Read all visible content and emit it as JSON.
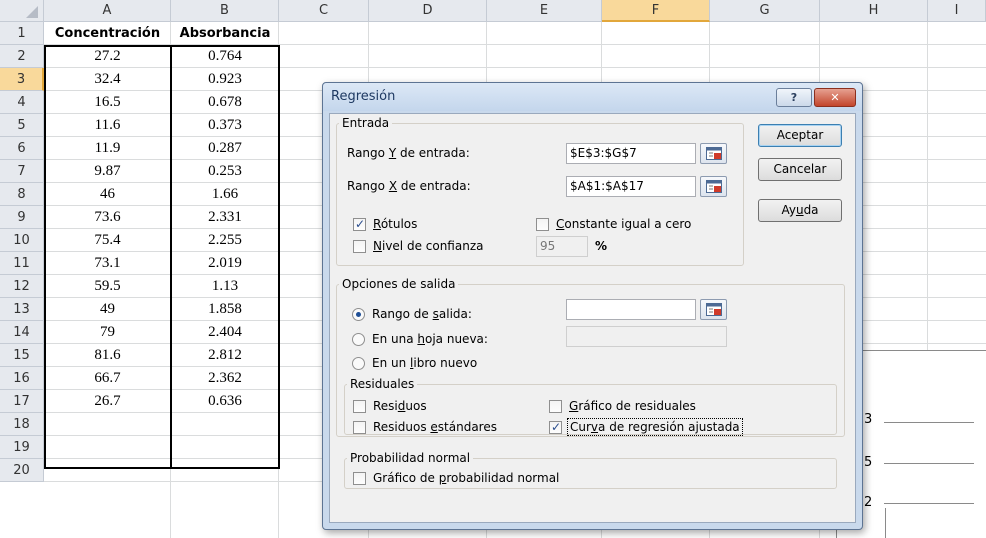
{
  "sheet": {
    "columns": [
      "A",
      "B",
      "C",
      "D",
      "E",
      "F",
      "G",
      "H",
      "I"
    ],
    "selected_column": "F",
    "rows": [
      "1",
      "2",
      "3",
      "4",
      "5",
      "6",
      "7",
      "8",
      "9",
      "10",
      "11",
      "12",
      "13",
      "14",
      "15",
      "16",
      "17",
      "18",
      "19",
      "20"
    ],
    "selected_row": "3",
    "header_a": "Concentración",
    "header_b": "Absorbancia",
    "data": [
      [
        "27.2",
        "0.764"
      ],
      [
        "32.4",
        "0.923"
      ],
      [
        "16.5",
        "0.678"
      ],
      [
        "11.6",
        "0.373"
      ],
      [
        "11.9",
        "0.287"
      ],
      [
        "9.87",
        "0.253"
      ],
      [
        "46",
        "1.66"
      ],
      [
        "73.6",
        "2.331"
      ],
      [
        "75.4",
        "2.255"
      ],
      [
        "73.1",
        "2.019"
      ],
      [
        "59.5",
        "1.13"
      ],
      [
        "49",
        "1.858"
      ],
      [
        "79",
        "2.404"
      ],
      [
        "81.6",
        "2.812"
      ],
      [
        "66.7",
        "2.362"
      ],
      [
        "26.7",
        "0.636"
      ]
    ],
    "chart_fragments": [
      "3",
      "5",
      "2"
    ]
  },
  "dialog": {
    "title": "Regresión",
    "help_glyph": "?",
    "close_glyph": "✕",
    "entrada": {
      "legend": "Entrada",
      "rango_y_label_pre": "Rango ",
      "rango_y_label_key": "Y",
      "rango_y_label_post": " de entrada:",
      "rango_y_value": "$E$3:$G$7",
      "rango_x_label_pre": "Rango ",
      "rango_x_label_key": "X",
      "rango_x_label_post": " de entrada:",
      "rango_x_value": "$A$1:$A$17",
      "rotulos_key": "R",
      "rotulos_rest": "ótulos",
      "rotulos_checked": true,
      "constante_key": "C",
      "constante_rest": "onstante igual a cero",
      "constante_checked": false,
      "nivel_key": "N",
      "nivel_rest": "ivel de confianza",
      "nivel_checked": false,
      "nivel_value": "95",
      "nivel_unit": "%"
    },
    "salida": {
      "legend": "Opciones de salida",
      "rango_salida_pre": "Rango de ",
      "rango_salida_key": "s",
      "rango_salida_post": "alida:",
      "rango_salida_value": "",
      "hoja_pre": "En una ",
      "hoja_key": "h",
      "hoja_post": "oja nueva:",
      "hoja_value": "",
      "libro_pre": "En un ",
      "libro_key": "l",
      "libro_post": "ibro nuevo",
      "selected_option": "rango_salida"
    },
    "residuales": {
      "legend": "Residuales",
      "residuos_pre": "Resi",
      "residuos_key": "d",
      "residuos_post": "uos",
      "residuos_checked": false,
      "estandares_pre": "Residuos ",
      "estandares_key": "e",
      "estandares_post": "stándares",
      "estandares_checked": false,
      "grafico_key": "G",
      "grafico_rest": "ráfico de residuales",
      "grafico_checked": false,
      "curva_pre": "Cur",
      "curva_key": "v",
      "curva_post": "a de regresión ajustada",
      "curva_checked": true
    },
    "probabilidad": {
      "legend": "Probabilidad normal",
      "grafico_pre": "Gráfico de ",
      "grafico_key": "p",
      "grafico_post": "robabilidad normal",
      "grafico_checked": false
    },
    "buttons": {
      "aceptar": "Aceptar",
      "cancelar": "Cancelar",
      "ayuda_pre": "Ay",
      "ayuda_key": "u",
      "ayuda_post": "da"
    },
    "check_glyph": "✓"
  }
}
